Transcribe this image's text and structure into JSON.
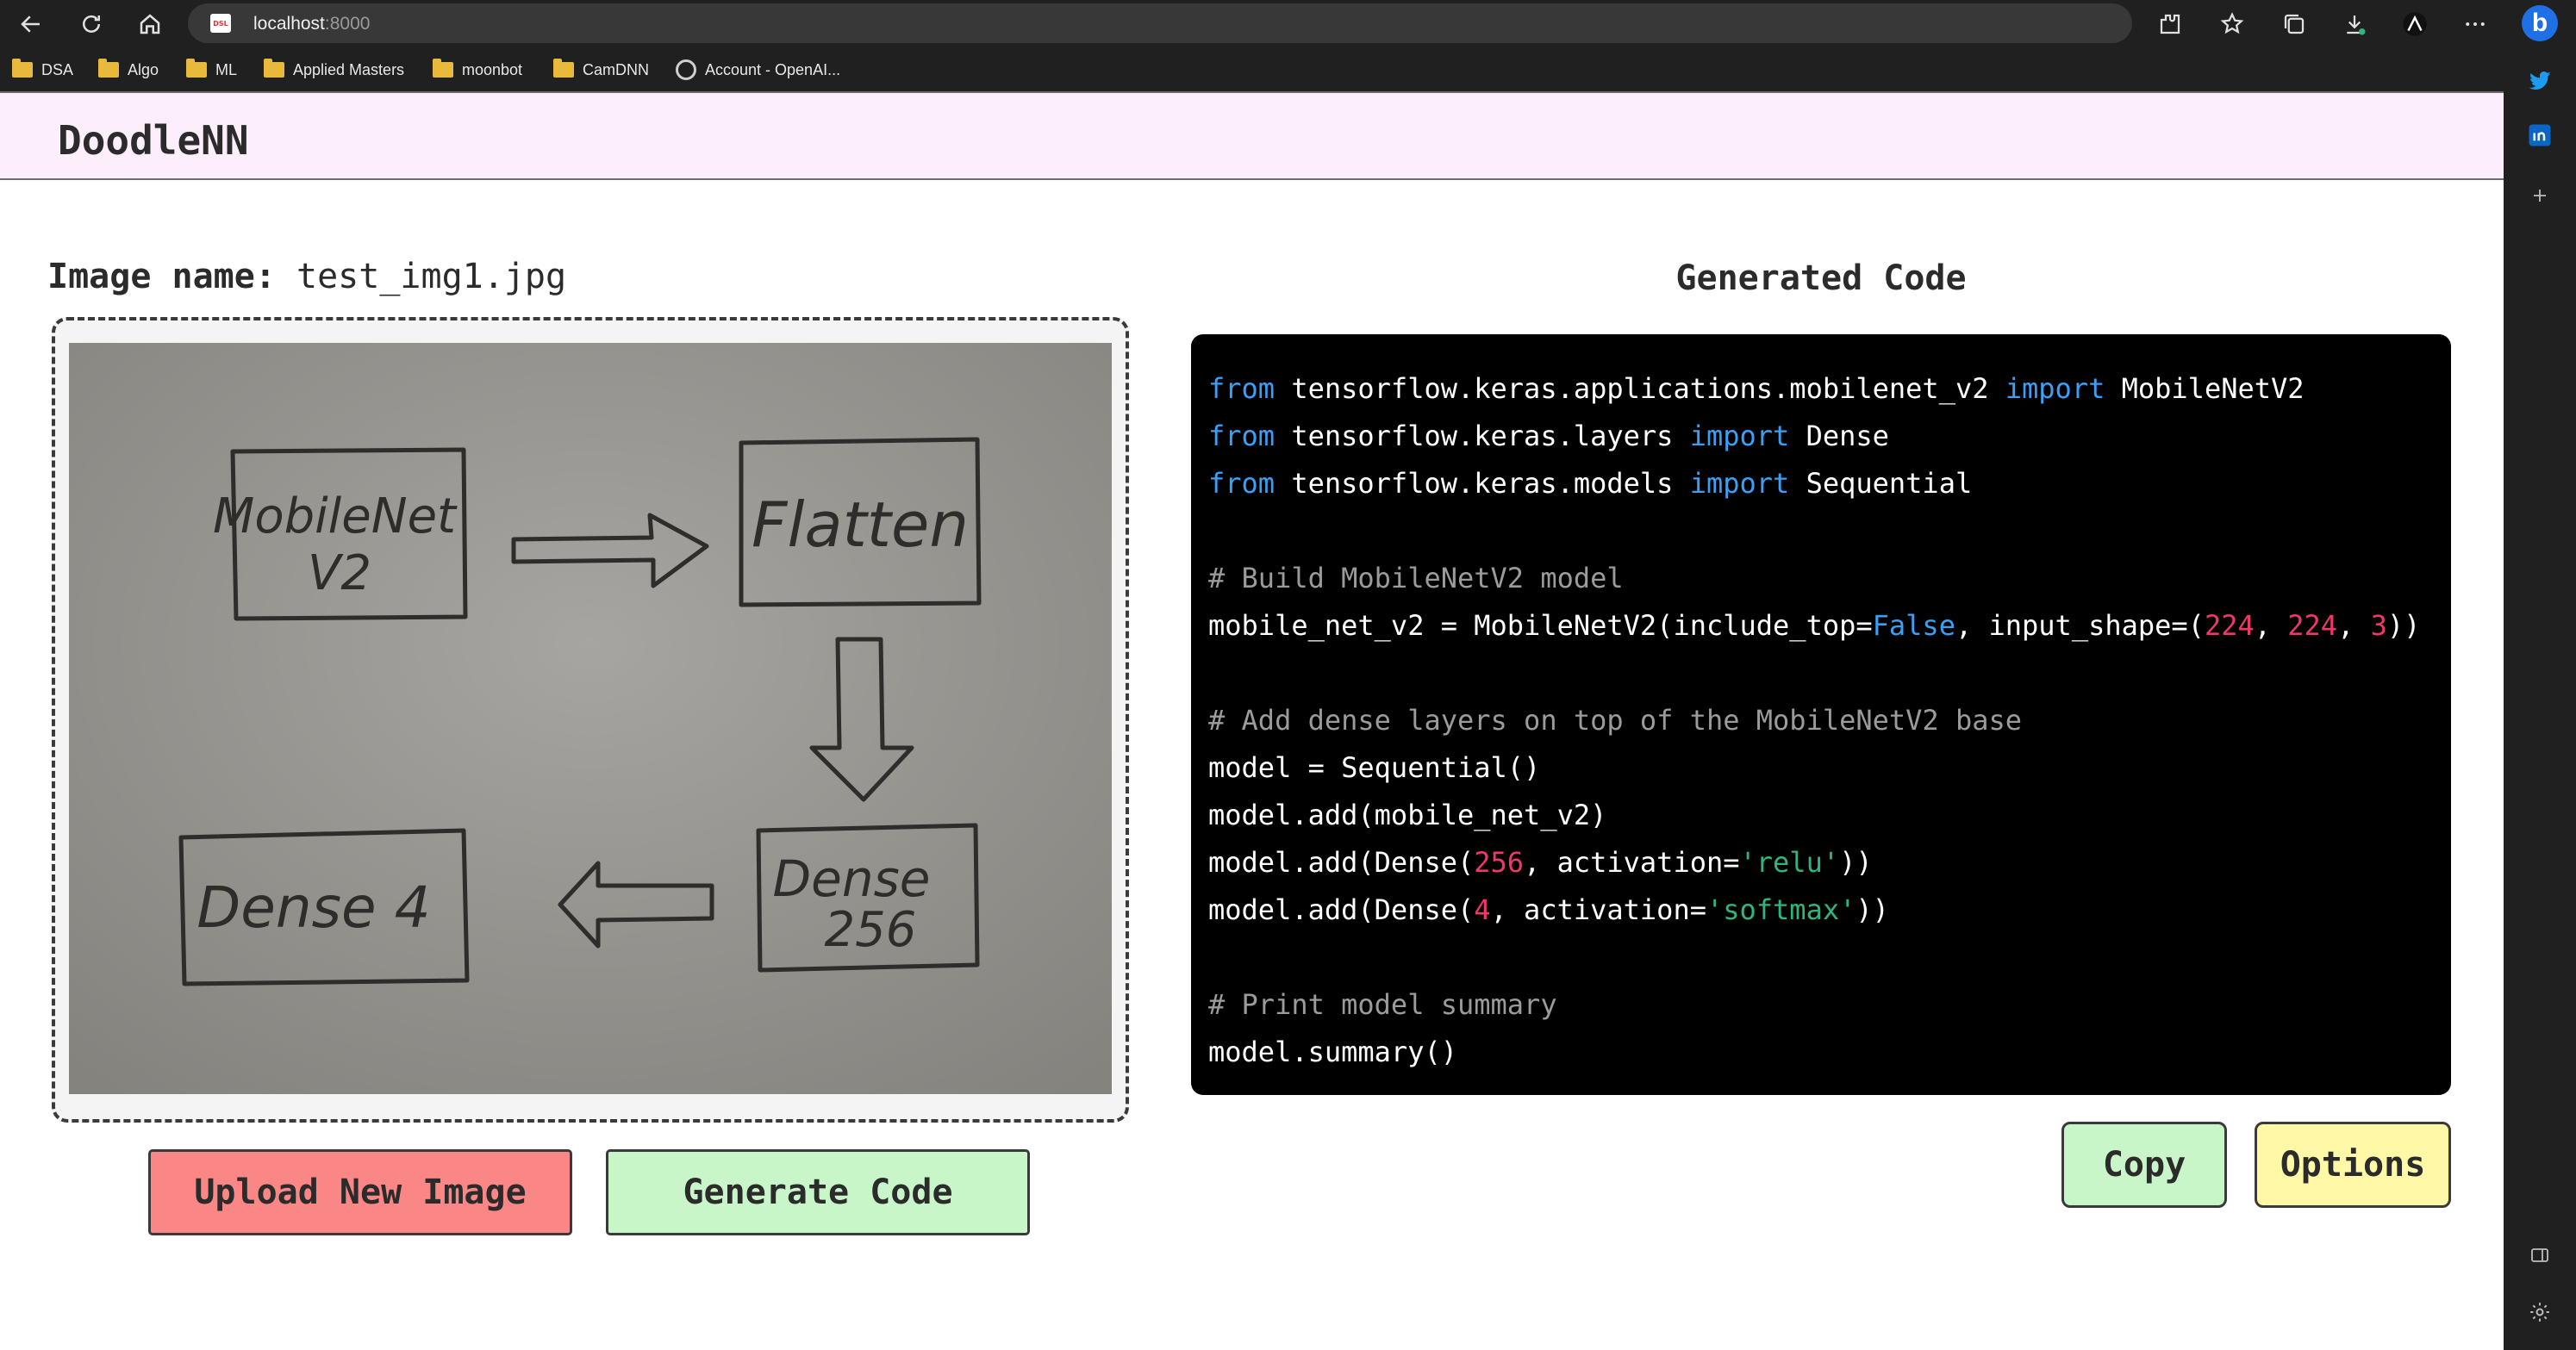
{
  "browser": {
    "address": "localhost",
    "port": ":8000",
    "bookmarks": [
      "DSA",
      "Algo",
      "ML",
      "Applied Masters",
      "moonbot",
      "CamDNN",
      "Account - OpenAI..."
    ]
  },
  "app": {
    "title": "DoodleNN"
  },
  "left": {
    "image_label": "Image name:",
    "image_name": "test_img1.jpg",
    "sketch": {
      "box1": [
        "MobileNet",
        "V2"
      ],
      "box2": "Flatten",
      "box3": [
        "Dense",
        "256"
      ],
      "box4": "Dense 4"
    },
    "upload_label": "Upload New Image",
    "generate_label": "Generate Code"
  },
  "right": {
    "heading": "Generated Code",
    "code": {
      "l1_kw1": "from",
      "l1_mod": " tensorflow.keras.applications.mobilenet_v2 ",
      "l1_kw2": "import",
      "l1_name": " MobileNetV2",
      "l2_kw1": "from",
      "l2_mod": " tensorflow.keras.layers ",
      "l2_kw2": "import",
      "l2_name": " Dense",
      "l3_kw1": "from",
      "l3_mod": " tensorflow.keras.models ",
      "l3_kw2": "import",
      "l3_name": " Sequential",
      "c1": "# Build MobileNetV2 model",
      "l5_a": "mobile_net_v2 = MobileNetV2(include_top=",
      "l5_false": "False",
      "l5_b": ", input_shape=(",
      "l5_n1": "224",
      "l5_c": ", ",
      "l5_n2": "224",
      "l5_d": ", ",
      "l5_n3": "3",
      "l5_e": "))",
      "c2": "# Add dense layers on top of the MobileNetV2 base",
      "l7": "model = Sequential()",
      "l8": "model.add(mobile_net_v2)",
      "l9_a": "model.add(Dense(",
      "l9_n": "256",
      "l9_b": ", activation=",
      "l9_s": "'relu'",
      "l9_c": "))",
      "l10_a": "model.add(Dense(",
      "l10_n": "4",
      "l10_b": ", activation=",
      "l10_s": "'softmax'",
      "l10_c": "))",
      "c3": "# Print model summary",
      "l12": "model.summary()"
    },
    "copy_label": "Copy",
    "options_label": "Options"
  }
}
